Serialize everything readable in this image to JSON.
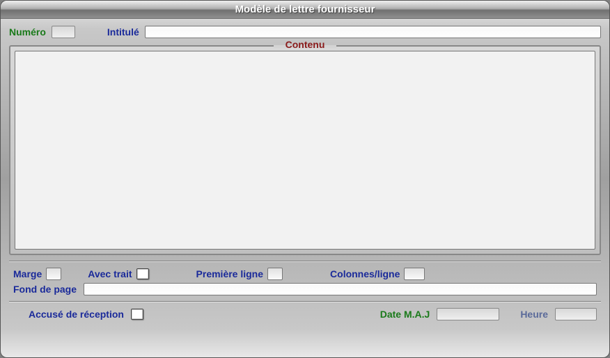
{
  "window": {
    "title": "Modèle de lettre fournisseur"
  },
  "header": {
    "numero_label": "Numéro",
    "numero_value": "",
    "intitule_label": "Intitulé",
    "intitule_value": ""
  },
  "content": {
    "legend": "Contenu",
    "text": ""
  },
  "options": {
    "marge_label": "Marge",
    "marge_value": "",
    "avec_trait_label": "Avec trait",
    "avec_trait_checked": false,
    "premiere_ligne_label": "Première ligne",
    "premiere_ligne_value": "",
    "colonnes_ligne_label": "Colonnes/ligne",
    "colonnes_ligne_value": "",
    "fond_de_page_label": "Fond de page",
    "fond_de_page_value": ""
  },
  "footer": {
    "accuse_label": "Accusé de réception",
    "accuse_checked": false,
    "date_maj_label": "Date M.A.J",
    "date_maj_value": "",
    "heure_label": "Heure",
    "heure_value": ""
  }
}
